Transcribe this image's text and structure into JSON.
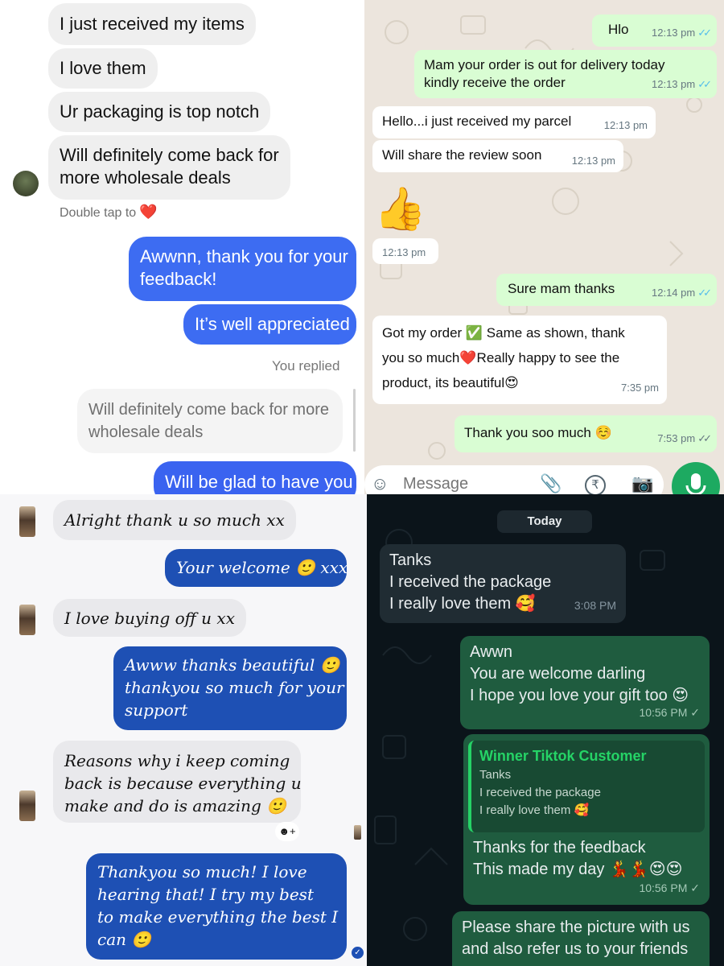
{
  "instagram": {
    "incoming": [
      "I just received my items",
      "I love them",
      "Ur packaging is top notch",
      [
        "Will definitely come back for",
        "more wholesale deals"
      ]
    ],
    "double_tap_hint": "Double tap to",
    "heart_icon": "❤️",
    "outgoing": [
      [
        "Awwnn, thank you for your",
        "feedback!"
      ],
      "It’s well appreciated"
    ],
    "you_replied": "You replied",
    "quoted": [
      "Will definitely come back for more",
      "wholesale deals"
    ],
    "last_out": "Will be glad to have you",
    "colors": {
      "outgoing": "#3d6cf2",
      "incoming": "#efefef"
    }
  },
  "whatsapp_light": {
    "messages": [
      {
        "dir": "out",
        "lines": [
          "Hlo"
        ],
        "time": "12:13 pm",
        "tick": "✓✓"
      },
      {
        "dir": "out",
        "lines": [
          "Mam your order is out for delivery today",
          "kindly receive the order"
        ],
        "time": "12:13 pm",
        "tick": "✓✓"
      },
      {
        "dir": "in",
        "lines": [
          "Hello...i just received my parcel"
        ],
        "time": "12:13 pm"
      },
      {
        "dir": "in",
        "lines": [
          "Will share the review soon"
        ],
        "time": "12:13 pm"
      },
      {
        "dir": "in",
        "emoji": "👍",
        "time": "12:13 pm"
      },
      {
        "dir": "out",
        "lines": [
          "Sure mam thanks"
        ],
        "time": "12:14 pm",
        "tick": "✓✓"
      },
      {
        "dir": "in",
        "lines": [
          "Got my order ✅ Same as shown, thank",
          "you so much❤️Really happy to see the",
          "product, its beautiful😍"
        ],
        "time": "7:35 pm"
      },
      {
        "dir": "out",
        "lines": [
          "Thank you soo much ☺️"
        ],
        "time": "7:53 pm",
        "tick": "✓✓"
      }
    ],
    "composer_placeholder": "Message",
    "icons": [
      "sticker-icon",
      "attach-icon",
      "rupee-icon",
      "camera-icon",
      "mic-icon"
    ],
    "colors": {
      "outgoing": "#d9fdd3",
      "incoming": "#ffffff",
      "mic": "#1daa61"
    }
  },
  "messenger": {
    "messages": [
      {
        "dir": "in",
        "lines": [
          "Alright thank u so much xx"
        ]
      },
      {
        "dir": "out",
        "lines": [
          "Your welcome 🙂 xxx"
        ]
      },
      {
        "dir": "in",
        "lines": [
          "I love buying off u xx"
        ]
      },
      {
        "dir": "out",
        "lines": [
          "Awww thanks beautiful 🙂",
          "thankyou so much for your",
          "support"
        ]
      },
      {
        "dir": "in",
        "lines": [
          "Reasons why i keep coming",
          "back is because everything u",
          "make and do is amazing 🙂"
        ]
      },
      {
        "dir": "out",
        "lines": [
          "Thankyou so much! I love",
          "hearing that! I try my best",
          "to make everything the best I",
          "can 🙂"
        ]
      }
    ],
    "add_reaction": "☻+",
    "seen_check": "✓",
    "colors": {
      "outgoing": "#1e50b4",
      "incoming": "#e9e9ec"
    }
  },
  "whatsapp_dark": {
    "date_chip": "Today",
    "messages": [
      {
        "dir": "in",
        "lines": [
          "Tanks",
          "I received the package",
          "I really love them 🥰"
        ],
        "time": "3:08 PM"
      },
      {
        "dir": "out",
        "lines": [
          "Awwn",
          "You are welcome darling",
          "I hope you love your gift too 😍"
        ],
        "time": "10:56 PM",
        "tick": "✓"
      },
      {
        "dir": "out",
        "quote": {
          "name": "Winner Tiktok Customer",
          "lines": [
            "Tanks",
            "I received the package",
            "I really love them 🥰"
          ]
        },
        "lines": [
          "Thanks for the feedback",
          "This made my day 💃💃😍😍"
        ],
        "time": "10:56 PM",
        "tick": "✓"
      },
      {
        "dir": "out",
        "lines": [
          "Please share the picture with us",
          "and also refer us to your friends"
        ]
      }
    ],
    "colors": {
      "outgoing": "#1f5c3f",
      "incoming": "#202c33",
      "background": "#0b141a"
    }
  }
}
